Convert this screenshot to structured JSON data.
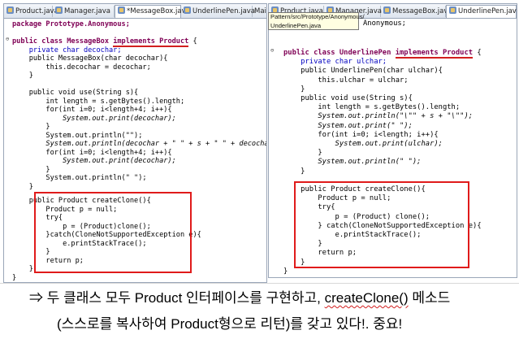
{
  "left": {
    "tabs": [
      {
        "label": "Product.java"
      },
      {
        "label": "Manager.java"
      },
      {
        "label": "*MessageBox.java"
      },
      {
        "label": "UnderlinePen.java"
      },
      {
        "label": "Mai"
      }
    ]
  },
  "right": {
    "tabs": [
      {
        "label": "Product.java"
      },
      {
        "label": "Manager.java"
      },
      {
        "label": "MessageBox.java"
      },
      {
        "label": "UnderlinePen.java"
      }
    ],
    "tooltip": {
      "line1": "Pattern/src/Prototype/Anonymous/",
      "line2": "UnderlinePen.java"
    }
  },
  "code_left": {
    "l0": "package Prototype.Anonymous;",
    "l2a": "public class MessageBox ",
    "l2b": "implements Product",
    "l2c": " {",
    "l3": "    private char decochar;",
    "l4": "    public MessageBox(char decochar){",
    "l5": "        this.decochar = decochar;",
    "l6": "    }",
    "l8": "    public void use(String s){",
    "l9": "        int length = s.getBytes().length;",
    "l10": "        for(int i=0; i<length+4; i++){",
    "l11": "            System.out.print(decochar);",
    "l12": "        }",
    "l13": "        System.out.println(\"\");",
    "l14": "        System.out.println(decochar + \" \" + s + \" \" + decochar);",
    "l15": "        for(int i=0; i<length+4; i++){",
    "l16": "            System.out.print(decochar);",
    "l17": "        }",
    "l18": "        System.out.println(\" \");",
    "l19": "    }",
    "l21": "    public Product createClone(){",
    "l22": "        Product p = null;",
    "l23": "        try{",
    "l24": "            p = (Product)clone();",
    "l25": "        }catch(CloneNotSupportedException e){",
    "l26": "            e.printStackTrace();",
    "l27": "        }",
    "l28": "        return p;",
    "l29": "    }",
    "l30": "}"
  },
  "code_right": {
    "r0": "Anonymous;",
    "r2a": "public class UnderlinePen ",
    "r2b": "implements Product",
    "r2c": " {",
    "r3": "    private char ulchar;",
    "r4": "    public UnderlinePen(char ulchar){",
    "r5": "        this.ulchar = ulchar;",
    "r6": "    }",
    "r7": "    public void use(String s){",
    "r8": "        int length = s.getBytes().length;",
    "r9": "        System.out.println(\"\\\"\" + s + \"\\\"\");",
    "r10": "        System.out.print(\" \");",
    "r11": "        for(int i=0; i<length; i++){",
    "r12": "            System.out.print(ulchar);",
    "r13": "        }",
    "r14": "        System.out.println(\" \");",
    "r15": "    }",
    "r17": "    public Product createClone(){",
    "r18": "        Product p = null;",
    "r19": "        try{",
    "r20": "            p = (Product) clone();",
    "r21": "        } catch(CloneNotSupportedException e){",
    "r22": "            e.printStackTrace();",
    "r23": "        }",
    "r24": "        return p;",
    "r25": "    }",
    "r26": "}"
  },
  "caption": {
    "line1a": "⇒ 두 클래스 모두 Product 인터페이스를 구현하고, ",
    "line1b": "createClone()",
    "line1c": " 메소드",
    "line2": "(스스로를 복사하여 Product형으로 리턴)를 갖고 있다!. 중요!"
  },
  "colors": {
    "keyword": "#7f0055",
    "field": "#0000c0",
    "highlight_box": "#e01b1b",
    "underline": "#d21e1e"
  }
}
